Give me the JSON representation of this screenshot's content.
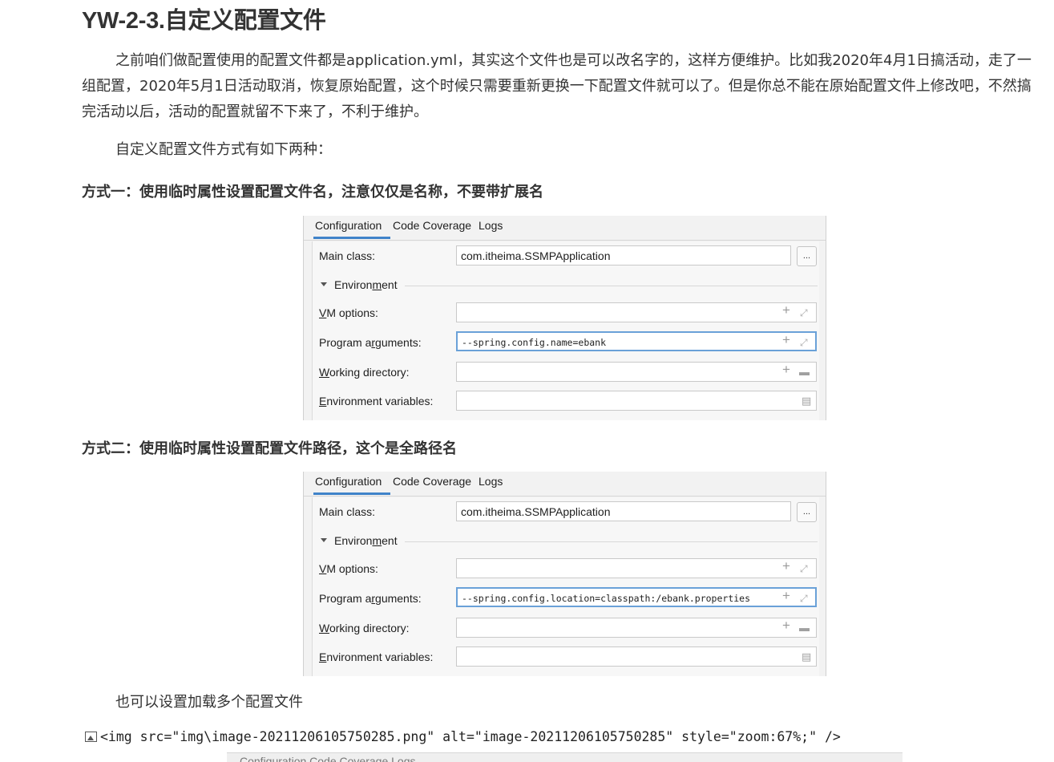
{
  "title": "YW-2-3.自定义配置文件",
  "paragraph1": "之前咱们做配置使用的配置文件都是application.yml，其实这个文件也是可以改名字的，这样方便维护。比如我2020年4月1日搞活动，走了一组配置，2020年5月1日活动取消，恢复原始配置，这个时候只需要重新更换一下配置文件就可以了。但是你总不能在原始配置文件上修改吧，不然搞完活动以后，活动的配置就留不下来了，不利于维护。",
  "paragraph2": "自定义配置文件方式有如下两种：",
  "method1": "方式一：使用临时属性设置配置文件名，注意仅仅是名称，不要带扩展名",
  "method2": "方式二：使用临时属性设置配置文件路径，这个是全路径名",
  "paragraph3": "也可以设置加载多个配置文件",
  "img_line": "<img src=\"img\\image-20211206105750285.png\" alt=\"image-20211206105750285\" style=\"zoom:67%;\" />",
  "peek_text": "Configuration  Code Coverage  Logs",
  "panels": [
    {
      "tabs": [
        "Configuration",
        "Code Coverage",
        "Logs"
      ],
      "main_class_label": "Main class:",
      "main_class_value": "com.itheima.SSMPApplication",
      "dots_label": "...",
      "env_label_pre": "Environ",
      "env_label_u": "m",
      "env_label_post": "ent",
      "vm_label_u": "V",
      "vm_label_rest": "M options:",
      "vm_value": "",
      "prog_label_pre": "Program a",
      "prog_label_u": "r",
      "prog_label_post": "guments:",
      "prog_value": "--spring.config.name=ebank",
      "wd_label_u": "W",
      "wd_label_rest": "orking directory:",
      "wd_value": "",
      "ev_label_u": "E",
      "ev_label_rest": "nvironment variables:",
      "ev_value": ""
    },
    {
      "tabs": [
        "Configuration",
        "Code Coverage",
        "Logs"
      ],
      "main_class_label": "Main class:",
      "main_class_value": "com.itheima.SSMPApplication",
      "dots_label": "...",
      "env_label_pre": "Environ",
      "env_label_u": "m",
      "env_label_post": "ent",
      "vm_label_u": "V",
      "vm_label_rest": "M options:",
      "vm_value": "",
      "prog_label_pre": "Program a",
      "prog_label_u": "r",
      "prog_label_post": "guments:",
      "prog_value": "--spring.config.location=classpath:/ebank.properties",
      "wd_label_u": "W",
      "wd_label_rest": "orking directory:",
      "wd_value": "",
      "ev_label_u": "E",
      "ev_label_rest": "nvironment variables:",
      "ev_value": ""
    }
  ],
  "icons": {
    "plus": "+",
    "expand": "⤢",
    "folder": "▬",
    "doc": "▤"
  }
}
